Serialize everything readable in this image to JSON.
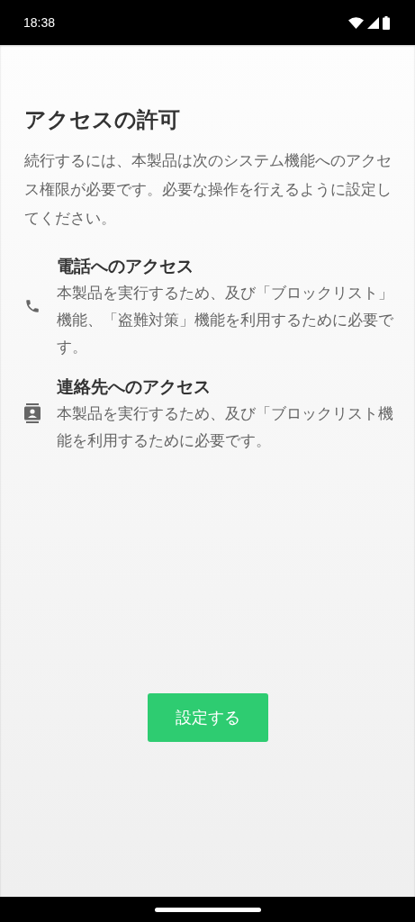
{
  "status_bar": {
    "time": "18:38"
  },
  "title": "アクセスの許可",
  "description": "続行するには、本製品は次のシステム機能へのアクセス権限が必要です。必要な操作を行えるように設定してください。",
  "permissions": [
    {
      "kind": "phone",
      "title": "電話へのアクセス",
      "description": "本製品を実行するため、及び「ブロックリスト」機能、「盗難対策」機能を利用するために必要です。"
    },
    {
      "kind": "contacts",
      "title": "連絡先へのアクセス",
      "description": "本製品を実行するため、及び「ブロックリスト機能を利用するために必要です。"
    }
  ],
  "button": "設定する"
}
